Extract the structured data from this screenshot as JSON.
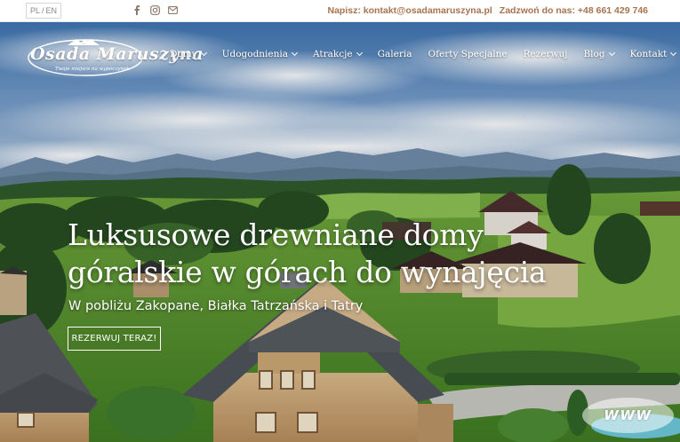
{
  "topbar": {
    "lang_pl": "PL",
    "lang_sep": "/",
    "lang_en": "EN",
    "social_icons": [
      "facebook-icon",
      "instagram-icon",
      "mail-icon"
    ],
    "email_text": "Napisz: kontakt@osadamaruszyna.pl",
    "phone_text": "Zadzwoń do nas: +48 661 429 746"
  },
  "logo": {
    "name": "Osada Maruszyna",
    "tagline": "Twoje miejsce na wypoczynek"
  },
  "nav": {
    "items": [
      {
        "label": "Domy",
        "dropdown": true
      },
      {
        "label": "Udogodnienia",
        "dropdown": true
      },
      {
        "label": "Atrakcje",
        "dropdown": true
      },
      {
        "label": "Galeria",
        "dropdown": false
      },
      {
        "label": "Oferty Specjalne",
        "dropdown": false
      },
      {
        "label": "Rezerwuj",
        "dropdown": false
      },
      {
        "label": "Blog",
        "dropdown": true
      },
      {
        "label": "Kontakt",
        "dropdown": true
      }
    ]
  },
  "hero": {
    "headline_line1": "Luksusowe drewniane domy",
    "headline_line2": "góralskie w górach do wynajęcia",
    "subtitle": "W pobliżu Zakopane, Białka Tatrzańska i Tatry",
    "cta": "REZERWUJ TERAZ!"
  },
  "badge": {
    "text": "WWW"
  },
  "colors": {
    "accent": "#a8734f",
    "topbar_bg": "#ffffff",
    "sky": "#4f7fb6"
  }
}
